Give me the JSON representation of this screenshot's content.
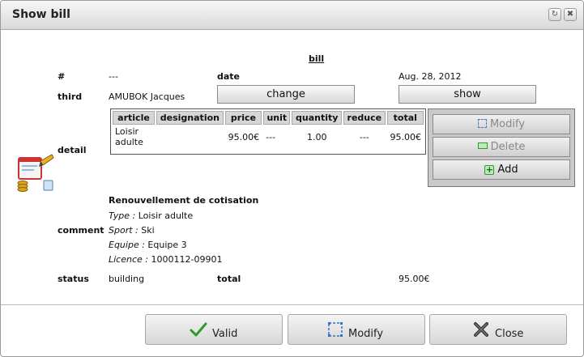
{
  "window": {
    "title": "Show bill"
  },
  "header": {
    "section_title": "bill"
  },
  "fields": {
    "number_label": "#",
    "number_value": "---",
    "date_label": "date",
    "date_value": "Aug. 28, 2012",
    "third_label": "third",
    "third_value": "AMUBOK Jacques",
    "change_label": "change",
    "show_label": "show",
    "detail_label": "detail",
    "comment_label": "comment",
    "status_label": "status",
    "status_value": "building",
    "total_label": "total",
    "total_value": "95.00€"
  },
  "detail": {
    "columns": [
      "article",
      "designation",
      "price",
      "unit",
      "quantity",
      "reduce",
      "total"
    ],
    "rows": [
      {
        "article": "Loisir adulte",
        "designation": "",
        "price": "95.00€",
        "unit": "---",
        "quantity": "1.00",
        "reduce": "---",
        "total": "95.00€"
      }
    ],
    "actions": {
      "modify": "Modify",
      "delete": "Delete",
      "add": "Add"
    }
  },
  "comment": {
    "heading": "Renouvellement de cotisation",
    "lines": [
      {
        "key": "Type :",
        "value": "Loisir adulte"
      },
      {
        "key": "Sport :",
        "value": "Ski"
      },
      {
        "key": "Equipe :",
        "value": "Equipe 3"
      },
      {
        "key": "Licence :",
        "value": "1000112-09901"
      }
    ]
  },
  "footer": {
    "valid": "Valid",
    "modify": "Modify",
    "close": "Close"
  },
  "colors": {
    "accent_green": "#2e9a2e",
    "panel_gray": "#c9c9c9"
  },
  "icons": [
    "refresh-icon",
    "close-icon",
    "bill-edit-icon",
    "checkmark-icon",
    "modify-icon",
    "close-x-icon",
    "delete-icon",
    "add-icon"
  ]
}
